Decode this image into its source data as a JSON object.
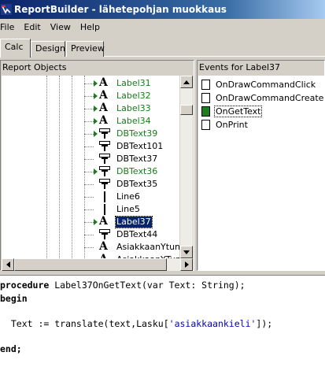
{
  "window": {
    "title": "ReportBuilder - lähetepohjan  muokkaus"
  },
  "menu": [
    "File",
    "Edit",
    "View",
    "Help"
  ],
  "tabs": [
    "Calc",
    "Design",
    "Preview"
  ],
  "left_panel": {
    "header": "Report Objects",
    "items": [
      {
        "label": "Label31",
        "icon": "label-a-icon",
        "green": true,
        "expander": true
      },
      {
        "label": "Label32",
        "icon": "label-a-icon",
        "green": true,
        "expander": true
      },
      {
        "label": "Label33",
        "icon": "label-a-icon",
        "green": true,
        "expander": true
      },
      {
        "label": "Label34",
        "icon": "label-a-icon",
        "green": true,
        "expander": true
      },
      {
        "label": "DBText39",
        "icon": "dbtext-icon",
        "green": true,
        "expander": true
      },
      {
        "label": "DBText101",
        "icon": "dbtext-icon",
        "green": false,
        "expander": false
      },
      {
        "label": "DBText37",
        "icon": "dbtext-icon",
        "green": false,
        "expander": false
      },
      {
        "label": "DBText36",
        "icon": "dbtext-icon",
        "green": true,
        "expander": true
      },
      {
        "label": "DBText35",
        "icon": "dbtext-icon",
        "green": false,
        "expander": false
      },
      {
        "label": "Line6",
        "icon": "line-icon",
        "green": false,
        "expander": false
      },
      {
        "label": "Line5",
        "icon": "line-icon",
        "green": false,
        "expander": false
      },
      {
        "label": "Label37",
        "icon": "label-a-icon",
        "green": false,
        "expander": true,
        "selected": true
      },
      {
        "label": "DBText44",
        "icon": "dbtext-icon",
        "green": false,
        "expander": false
      },
      {
        "label": "AsiakkaanYtunnu",
        "icon": "label-a-icon",
        "green": false,
        "expander": false
      },
      {
        "label": "AsiakkaanYTunn",
        "icon": "label-a-icon",
        "green": false,
        "expander": false
      }
    ]
  },
  "right_panel": {
    "header": "Events for Label37",
    "events": [
      {
        "label": "OnDrawCommandClick",
        "active": false
      },
      {
        "label": "OnDrawCommandCreate",
        "active": false
      },
      {
        "label": "OnGetText",
        "active": true,
        "selected": true
      },
      {
        "label": "OnPrint",
        "active": false
      }
    ]
  },
  "code": {
    "line1_kw": "procedure",
    "line1_rest": " Label37OnGetText(var Text: String);",
    "line2": "begin",
    "line3_pre": "  Text := translate(text,Lasku[",
    "line3_str": "'asiakkaankieli'",
    "line3_post": "]);",
    "line4": "end;"
  },
  "colors": {
    "title_start": "#0a246a",
    "selection": "#0a246a",
    "green_label": "#1b7a1b"
  }
}
